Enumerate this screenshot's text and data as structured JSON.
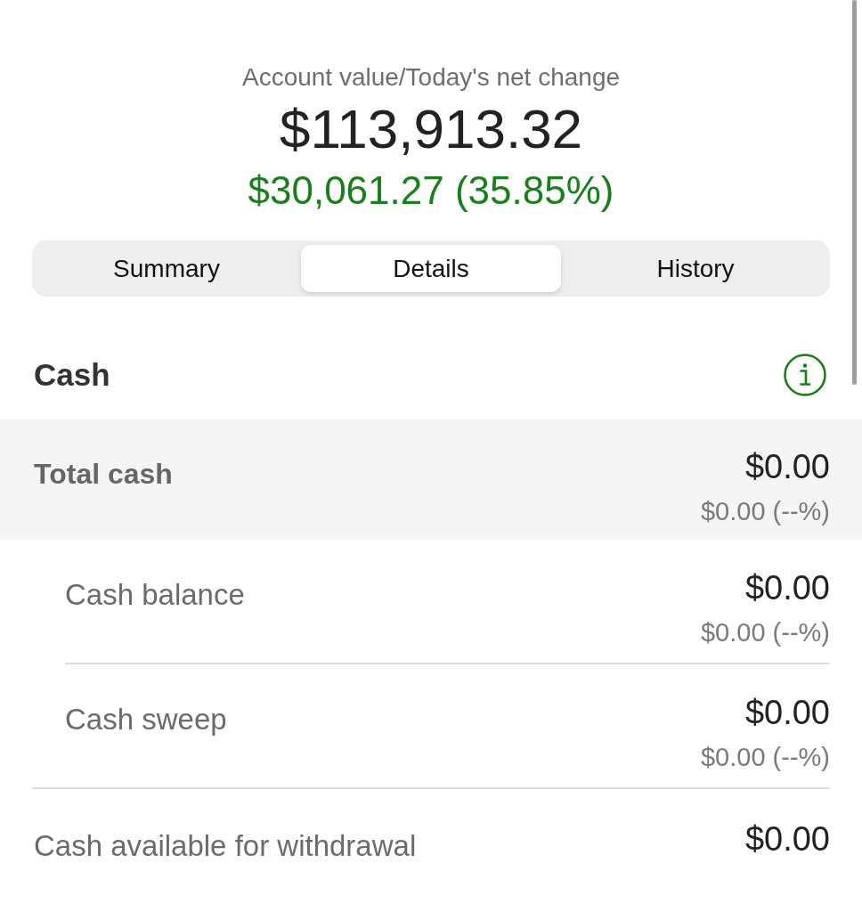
{
  "header": {
    "label": "Account value/Today's net change",
    "value": "$113,913.32",
    "change": "$30,061.27 (35.85%)"
  },
  "tabs": [
    {
      "label": "Summary",
      "selected": false
    },
    {
      "label": "Details",
      "selected": true
    },
    {
      "label": "History",
      "selected": false
    }
  ],
  "section": {
    "title": "Cash"
  },
  "rows": [
    {
      "kind": "total",
      "label": "Total cash",
      "value": "$0.00",
      "change": "$0.00 (--%)"
    },
    {
      "kind": "sub",
      "label": "Cash balance",
      "value": "$0.00",
      "change": "$0.00 (--%)"
    },
    {
      "kind": "sub",
      "label": "Cash sweep",
      "value": "$0.00",
      "change": "$0.00 (--%)"
    },
    {
      "kind": "plain",
      "label": "Cash available for withdrawal",
      "value": "$0.00"
    }
  ]
}
